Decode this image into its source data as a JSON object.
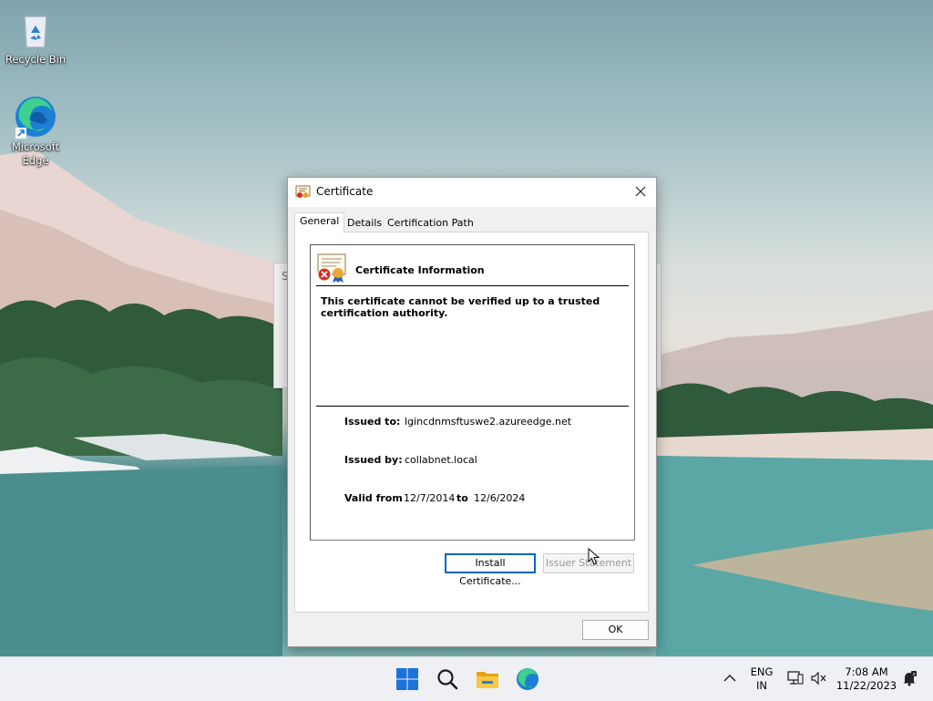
{
  "desktop": {
    "icons": [
      {
        "label": "Recycle Bin"
      },
      {
        "label": "Microsoft Edge"
      }
    ],
    "background_window_letter": "S"
  },
  "dialog": {
    "title": "Certificate",
    "tabs": [
      {
        "label": "General",
        "active": true
      },
      {
        "label": "Details",
        "active": false
      },
      {
        "label": "Certification Path",
        "active": false
      }
    ],
    "info_heading": "Certificate Information",
    "warning": "This certificate cannot be verified up to a trusted certification authority.",
    "issued_to_label": "Issued to:",
    "issued_to": "lgincdnmsftuswe2.azureedge.net",
    "issued_by_label": "Issued by:",
    "issued_by": "collabnet.local",
    "valid_from_label": "Valid from",
    "valid_from": "12/7/2014",
    "valid_to_label": "to",
    "valid_to": "12/6/2024",
    "install_button": "Install Certificate...",
    "issuer_button": "Issuer Statement",
    "ok_button": "OK"
  },
  "taskbar": {
    "pinned_icons": [
      "windows-start-icon",
      "search-icon",
      "file-explorer-icon",
      "edge-icon"
    ],
    "tray": {
      "language_line1": "ENG",
      "language_line2": "IN",
      "time": "7:08 AM",
      "date": "11/22/2023"
    }
  },
  "colors": {
    "accent": "#0067c0",
    "dialog_bg": "#f0f0f0",
    "taskbar_bg": "#eef0f3"
  }
}
